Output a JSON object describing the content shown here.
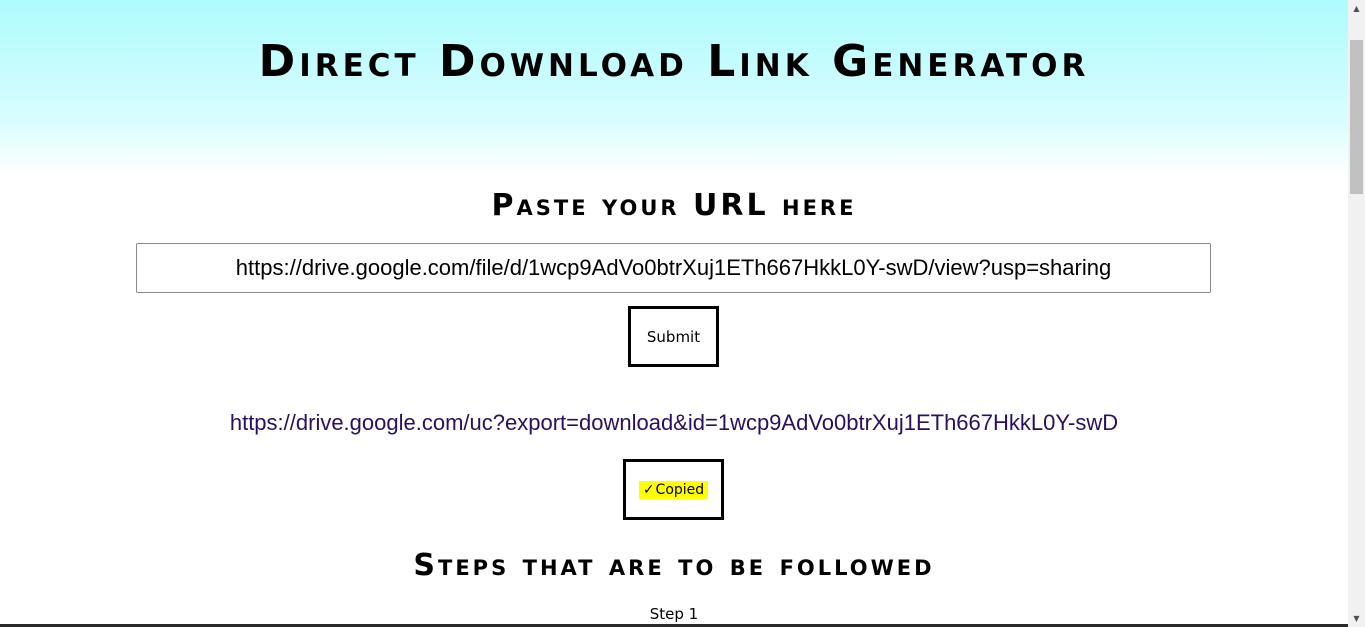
{
  "header": {
    "title": "Direct Download Link Generator"
  },
  "form": {
    "heading": "Paste your URL here",
    "url_value": "https://drive.google.com/file/d/1wcp9AdVo0btrXuj1ETh667HkkL0Y-swD/view?usp=sharing",
    "submit_label": "Submit"
  },
  "result": {
    "link": "https://drive.google.com/uc?export=download&id=1wcp9AdVo0btrXuj1ETh667HkkL0Y-swD",
    "copy_check": "✓",
    "copy_label": "Copied"
  },
  "steps": {
    "heading": "Steps that are to be followed",
    "first_step": "Step 1"
  },
  "icons": {
    "scroll_up": "▲",
    "scroll_down": "▼"
  },
  "colors": {
    "header_gradient_top": "#aefbfd",
    "link": "#2b0f5c",
    "copied_highlight": "#ffff00"
  }
}
